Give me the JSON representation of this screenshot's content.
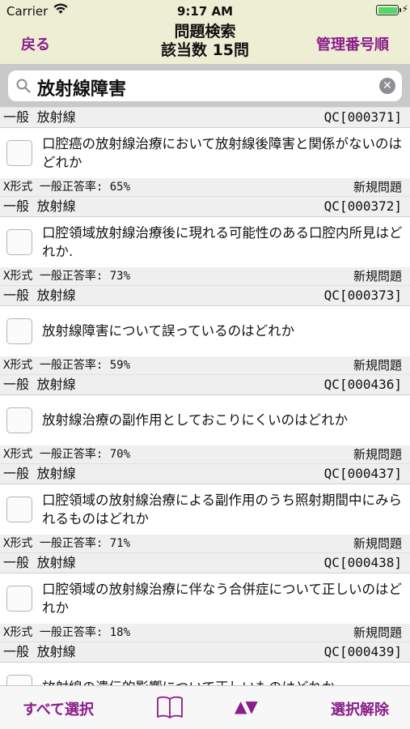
{
  "status": {
    "carrier": "Carrier",
    "time": "9:17 AM"
  },
  "nav": {
    "back_label": "戻る",
    "title_line1": "問題検索",
    "title_line2": "該当数 15問",
    "right_label": "管理番号順"
  },
  "search": {
    "value": "放射線障害"
  },
  "items": [
    {
      "category": "一般 放射線",
      "code": "QC[000371]",
      "question": "口腔癌の放射線治療において放射線後障害と関係がないのはどれか",
      "format": "X形式 一般正答率: 65%",
      "status": "新規問題"
    },
    {
      "category": "一般 放射線",
      "code": "QC[000372]",
      "question": "口腔領域放射線治療後に現れる可能性のある口腔内所見はどれか.",
      "format": "X形式 一般正答率: 73%",
      "status": "新規問題"
    },
    {
      "category": "一般 放射線",
      "code": "QC[000373]",
      "question": "放射線障害について誤っているのはどれか",
      "format": "X形式 一般正答率: 59%",
      "status": "新規問題"
    },
    {
      "category": "一般 放射線",
      "code": "QC[000436]",
      "question": "放射線治療の副作用としておこりにくいのはどれか",
      "format": "X形式 一般正答率: 70%",
      "status": "新規問題"
    },
    {
      "category": "一般 放射線",
      "code": "QC[000437]",
      "question": "口腔領域の放射線治療による副作用のうち照射期間中にみられるものはどれか",
      "format": "X形式 一般正答率: 71%",
      "status": "新規問題"
    },
    {
      "category": "一般 放射線",
      "code": "QC[000438]",
      "question": "口腔領域の放射線治療に伴なう合併症について正しいのはどれか",
      "format": "X形式 一般正答率: 18%",
      "status": "新規問題"
    },
    {
      "category": "一般 放射線",
      "code": "QC[000439]",
      "question": "放射線の遺伝的影響について正しいものはどれか",
      "format": "",
      "status": ""
    }
  ],
  "toolbar": {
    "select_all": "すべて選択",
    "sort_glyph": "▲▼",
    "clear_selection": "選択解除"
  },
  "colors": {
    "accent": "#8a1d8a",
    "bar": "#eeeed5"
  }
}
